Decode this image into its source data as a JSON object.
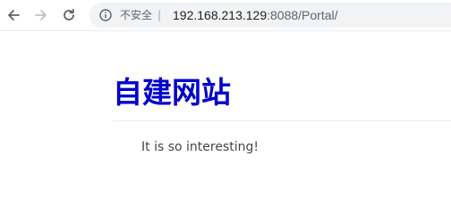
{
  "browser": {
    "security_label": "不安全",
    "security_separator": "|",
    "url_host": "192.168.213.129",
    "url_rest": ":8088/Portal/",
    "icons": {
      "back": "back-arrow-icon",
      "forward": "forward-arrow-icon",
      "reload": "reload-icon",
      "info": "info-icon"
    }
  },
  "page": {
    "title": "自建网站",
    "text": "It is so interesting!",
    "title_color": "#0000cc"
  }
}
